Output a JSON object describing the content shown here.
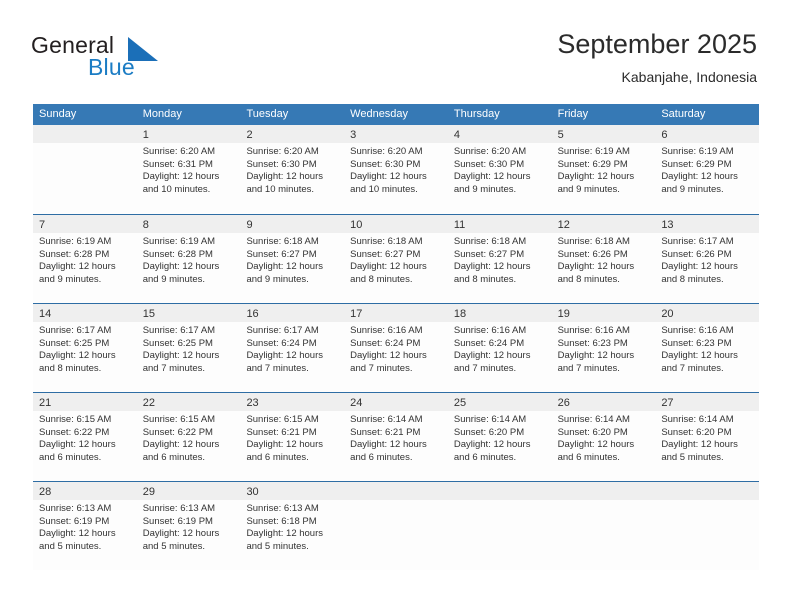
{
  "brand": {
    "name_part1": "General",
    "name_part2": "Blue",
    "triangle_color": "#1b6fb8",
    "blue_color": "#1b7cc4"
  },
  "header": {
    "title": "September 2025",
    "subtitle": "Kabanjahe, Indonesia"
  },
  "theme": {
    "header_band": "#3679b5",
    "row_divider": "#2e6da4",
    "day_band": "#efefef",
    "cell_bg": "#fdfdfd",
    "text": "#333333"
  },
  "weekdays": [
    {
      "label": "Sunday"
    },
    {
      "label": "Monday"
    },
    {
      "label": "Tuesday"
    },
    {
      "label": "Wednesday"
    },
    {
      "label": "Thursday"
    },
    {
      "label": "Friday"
    },
    {
      "label": "Saturday"
    }
  ],
  "weeks": [
    [
      {
        "day": "",
        "sunrise": "",
        "sunset": "",
        "daylight1": "",
        "daylight2": ""
      },
      {
        "day": "1",
        "sunrise": "Sunrise: 6:20 AM",
        "sunset": "Sunset: 6:31 PM",
        "daylight1": "Daylight: 12 hours",
        "daylight2": "and 10 minutes."
      },
      {
        "day": "2",
        "sunrise": "Sunrise: 6:20 AM",
        "sunset": "Sunset: 6:30 PM",
        "daylight1": "Daylight: 12 hours",
        "daylight2": "and 10 minutes."
      },
      {
        "day": "3",
        "sunrise": "Sunrise: 6:20 AM",
        "sunset": "Sunset: 6:30 PM",
        "daylight1": "Daylight: 12 hours",
        "daylight2": "and 10 minutes."
      },
      {
        "day": "4",
        "sunrise": "Sunrise: 6:20 AM",
        "sunset": "Sunset: 6:30 PM",
        "daylight1": "Daylight: 12 hours",
        "daylight2": "and 9 minutes."
      },
      {
        "day": "5",
        "sunrise": "Sunrise: 6:19 AM",
        "sunset": "Sunset: 6:29 PM",
        "daylight1": "Daylight: 12 hours",
        "daylight2": "and 9 minutes."
      },
      {
        "day": "6",
        "sunrise": "Sunrise: 6:19 AM",
        "sunset": "Sunset: 6:29 PM",
        "daylight1": "Daylight: 12 hours",
        "daylight2": "and 9 minutes."
      }
    ],
    [
      {
        "day": "7",
        "sunrise": "Sunrise: 6:19 AM",
        "sunset": "Sunset: 6:28 PM",
        "daylight1": "Daylight: 12 hours",
        "daylight2": "and 9 minutes."
      },
      {
        "day": "8",
        "sunrise": "Sunrise: 6:19 AM",
        "sunset": "Sunset: 6:28 PM",
        "daylight1": "Daylight: 12 hours",
        "daylight2": "and 9 minutes."
      },
      {
        "day": "9",
        "sunrise": "Sunrise: 6:18 AM",
        "sunset": "Sunset: 6:27 PM",
        "daylight1": "Daylight: 12 hours",
        "daylight2": "and 9 minutes."
      },
      {
        "day": "10",
        "sunrise": "Sunrise: 6:18 AM",
        "sunset": "Sunset: 6:27 PM",
        "daylight1": "Daylight: 12 hours",
        "daylight2": "and 8 minutes."
      },
      {
        "day": "11",
        "sunrise": "Sunrise: 6:18 AM",
        "sunset": "Sunset: 6:27 PM",
        "daylight1": "Daylight: 12 hours",
        "daylight2": "and 8 minutes."
      },
      {
        "day": "12",
        "sunrise": "Sunrise: 6:18 AM",
        "sunset": "Sunset: 6:26 PM",
        "daylight1": "Daylight: 12 hours",
        "daylight2": "and 8 minutes."
      },
      {
        "day": "13",
        "sunrise": "Sunrise: 6:17 AM",
        "sunset": "Sunset: 6:26 PM",
        "daylight1": "Daylight: 12 hours",
        "daylight2": "and 8 minutes."
      }
    ],
    [
      {
        "day": "14",
        "sunrise": "Sunrise: 6:17 AM",
        "sunset": "Sunset: 6:25 PM",
        "daylight1": "Daylight: 12 hours",
        "daylight2": "and 8 minutes."
      },
      {
        "day": "15",
        "sunrise": "Sunrise: 6:17 AM",
        "sunset": "Sunset: 6:25 PM",
        "daylight1": "Daylight: 12 hours",
        "daylight2": "and 7 minutes."
      },
      {
        "day": "16",
        "sunrise": "Sunrise: 6:17 AM",
        "sunset": "Sunset: 6:24 PM",
        "daylight1": "Daylight: 12 hours",
        "daylight2": "and 7 minutes."
      },
      {
        "day": "17",
        "sunrise": "Sunrise: 6:16 AM",
        "sunset": "Sunset: 6:24 PM",
        "daylight1": "Daylight: 12 hours",
        "daylight2": "and 7 minutes."
      },
      {
        "day": "18",
        "sunrise": "Sunrise: 6:16 AM",
        "sunset": "Sunset: 6:24 PM",
        "daylight1": "Daylight: 12 hours",
        "daylight2": "and 7 minutes."
      },
      {
        "day": "19",
        "sunrise": "Sunrise: 6:16 AM",
        "sunset": "Sunset: 6:23 PM",
        "daylight1": "Daylight: 12 hours",
        "daylight2": "and 7 minutes."
      },
      {
        "day": "20",
        "sunrise": "Sunrise: 6:16 AM",
        "sunset": "Sunset: 6:23 PM",
        "daylight1": "Daylight: 12 hours",
        "daylight2": "and 7 minutes."
      }
    ],
    [
      {
        "day": "21",
        "sunrise": "Sunrise: 6:15 AM",
        "sunset": "Sunset: 6:22 PM",
        "daylight1": "Daylight: 12 hours",
        "daylight2": "and 6 minutes."
      },
      {
        "day": "22",
        "sunrise": "Sunrise: 6:15 AM",
        "sunset": "Sunset: 6:22 PM",
        "daylight1": "Daylight: 12 hours",
        "daylight2": "and 6 minutes."
      },
      {
        "day": "23",
        "sunrise": "Sunrise: 6:15 AM",
        "sunset": "Sunset: 6:21 PM",
        "daylight1": "Daylight: 12 hours",
        "daylight2": "and 6 minutes."
      },
      {
        "day": "24",
        "sunrise": "Sunrise: 6:14 AM",
        "sunset": "Sunset: 6:21 PM",
        "daylight1": "Daylight: 12 hours",
        "daylight2": "and 6 minutes."
      },
      {
        "day": "25",
        "sunrise": "Sunrise: 6:14 AM",
        "sunset": "Sunset: 6:20 PM",
        "daylight1": "Daylight: 12 hours",
        "daylight2": "and 6 minutes."
      },
      {
        "day": "26",
        "sunrise": "Sunrise: 6:14 AM",
        "sunset": "Sunset: 6:20 PM",
        "daylight1": "Daylight: 12 hours",
        "daylight2": "and 6 minutes."
      },
      {
        "day": "27",
        "sunrise": "Sunrise: 6:14 AM",
        "sunset": "Sunset: 6:20 PM",
        "daylight1": "Daylight: 12 hours",
        "daylight2": "and 5 minutes."
      }
    ],
    [
      {
        "day": "28",
        "sunrise": "Sunrise: 6:13 AM",
        "sunset": "Sunset: 6:19 PM",
        "daylight1": "Daylight: 12 hours",
        "daylight2": "and 5 minutes."
      },
      {
        "day": "29",
        "sunrise": "Sunrise: 6:13 AM",
        "sunset": "Sunset: 6:19 PM",
        "daylight1": "Daylight: 12 hours",
        "daylight2": "and 5 minutes."
      },
      {
        "day": "30",
        "sunrise": "Sunrise: 6:13 AM",
        "sunset": "Sunset: 6:18 PM",
        "daylight1": "Daylight: 12 hours",
        "daylight2": "and 5 minutes."
      },
      {
        "day": "",
        "sunrise": "",
        "sunset": "",
        "daylight1": "",
        "daylight2": ""
      },
      {
        "day": "",
        "sunrise": "",
        "sunset": "",
        "daylight1": "",
        "daylight2": ""
      },
      {
        "day": "",
        "sunrise": "",
        "sunset": "",
        "daylight1": "",
        "daylight2": ""
      },
      {
        "day": "",
        "sunrise": "",
        "sunset": "",
        "daylight1": "",
        "daylight2": ""
      }
    ]
  ]
}
